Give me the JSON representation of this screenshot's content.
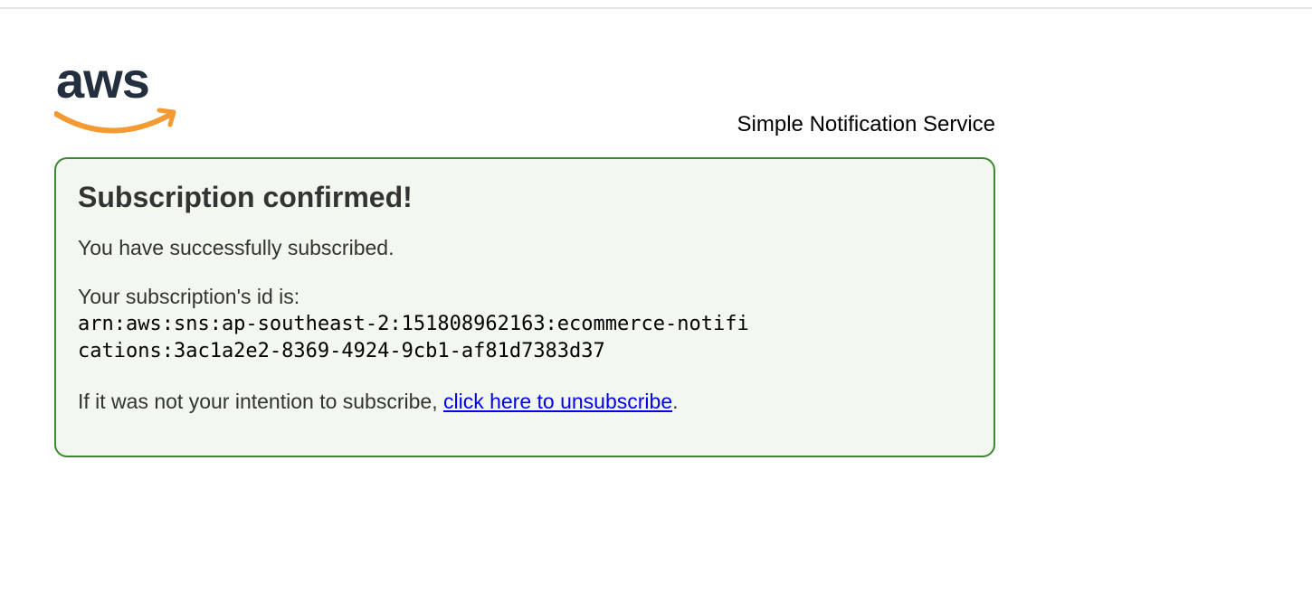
{
  "header": {
    "logo_text": "aws",
    "service_name": "Simple Notification Service",
    "colors": {
      "logo_text": "#232f3e",
      "logo_smile": "#f49a33"
    }
  },
  "panel": {
    "title": "Subscription confirmed!",
    "message": "You have successfully subscribed.",
    "id_label": "Your subscription's id is:",
    "subscription_arn": "arn:aws:sns:ap-southeast-2:151808962163:ecommerce-notifications:3ac1a2e2-8369-4924-9cb1-af81d7383d37",
    "unsubscribe_prefix": "If it was not your intention to subscribe, ",
    "unsubscribe_link": "click here to unsubscribe",
    "unsubscribe_suffix": ".",
    "colors": {
      "border": "#3b8a2f",
      "background": "#f2f7f0",
      "link": "#0000ee"
    }
  }
}
